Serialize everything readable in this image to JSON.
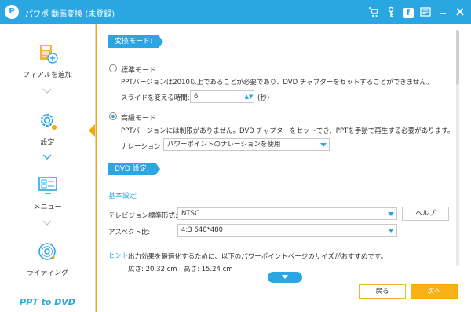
{
  "titlebar": {
    "title": "パワポ 動画変換 (未登録)",
    "logo_text": "P",
    "icons": [
      "cart-icon",
      "key-icon",
      "facebook-icon",
      "feedback-icon",
      "minimize-icon",
      "close-icon"
    ],
    "facebook_glyph": "f"
  },
  "sidebar": {
    "items": [
      {
        "label": "フィアルを追加",
        "icon": "add-file-icon"
      },
      {
        "label": "設定",
        "icon": "settings-gear-icon"
      },
      {
        "label": "メニュー",
        "icon": "menu-template-icon"
      },
      {
        "label": "ライティング",
        "icon": "burn-disc-icon"
      }
    ],
    "brand": "PPT to DVD"
  },
  "convert_section": {
    "header": "変換モード:",
    "standard": {
      "label": "標準モード",
      "description": "PPTバージョンは2010以上であることが必要であり、DVD チャプターをセットすることができません。",
      "slide_time_label": "スライドを変える時間:",
      "slide_time_value": "6",
      "slide_time_unit": "(秒)",
      "selected": false
    },
    "advanced": {
      "label": "高級モード",
      "description": "PPTバージョンには制限がありません。DVD チャプターをセットでき、PPTを手動で再生する必要があります。",
      "narration_label": "ナレーション:",
      "narration_value": "パワーポイントのナレーションを使用",
      "selected": true
    }
  },
  "dvd_section": {
    "header": "DVD 設定:",
    "basic_title": "基本設定",
    "tv_standard_label": "テレビジョン標準形式:",
    "tv_standard_value": "NTSC",
    "help_button": "ヘルプ",
    "aspect_label": "アスペクト比:",
    "aspect_value": "4:3 640*480"
  },
  "hint": {
    "label": "ヒント:",
    "text": "出力効果を最適化するために、以下のパワーポイントページのサイズがおすすめです。",
    "size": "広さ: 20.32 cm　高さ: 15.24 cm"
  },
  "footer": {
    "back_button": "戻る",
    "next_button": "次へ"
  },
  "colors": {
    "accent": "#2aa6e3",
    "orange": "#f5a800"
  }
}
